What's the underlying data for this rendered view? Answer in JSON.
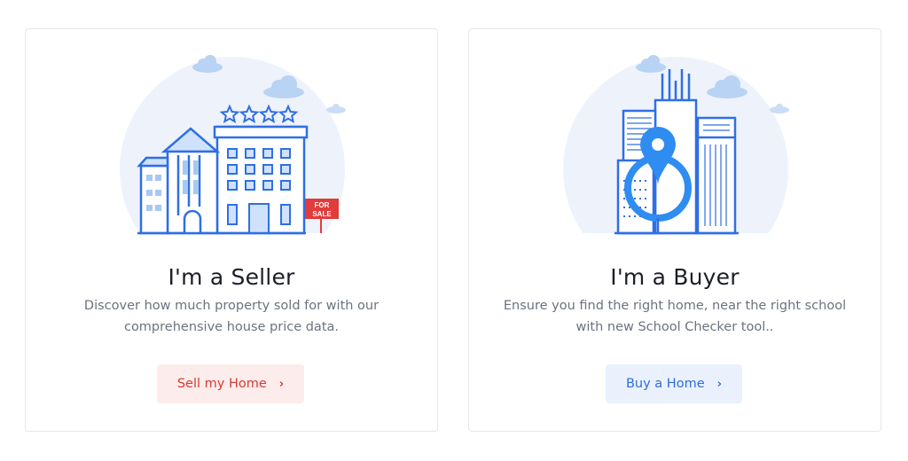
{
  "seller": {
    "title": "I'm a Seller",
    "description": "Discover how much property sold for with our comprehensive house price data.",
    "button_label": "Sell my Home",
    "sign_line1": "FOR",
    "sign_line2": "SALE",
    "accent": "#d63a2f",
    "button_bg": "#fdecec"
  },
  "buyer": {
    "title": "I'm a Buyer",
    "description": "Ensure you find the right home, near the right school with new School Checker tool..",
    "button_label": "Buy a Home",
    "accent": "#2d6fd6",
    "button_bg": "#eaf1fd"
  },
  "icons": {
    "chevron": "chevron-right-icon"
  }
}
